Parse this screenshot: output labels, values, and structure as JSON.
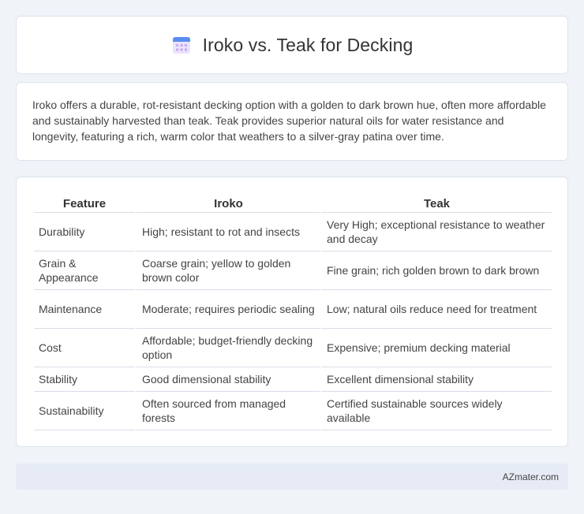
{
  "header": {
    "title": "Iroko vs. Teak for Decking",
    "icon": "calendar-icon",
    "icon_colors": {
      "top": "#5b8def",
      "grid": "#c9a6f5",
      "body": "#e9e3fb"
    }
  },
  "intro": {
    "text": "Iroko offers a durable, rot-resistant decking option with a golden to dark brown hue, often more affordable and sustainably harvested than teak. Teak provides superior natural oils for water resistance and longevity, featuring a rich, warm color that weathers to a silver-gray patina over time."
  },
  "table": {
    "headers": [
      "Feature",
      "Iroko",
      "Teak"
    ],
    "rows": [
      {
        "feature": "Durability",
        "iroko": "High; resistant to rot and insects",
        "teak": "Very High; exceptional resistance to weather and decay"
      },
      {
        "feature": "Grain & Appearance",
        "iroko": "Coarse grain; yellow to golden brown color",
        "teak": "Fine grain; rich golden brown to dark brown"
      },
      {
        "feature": "Maintenance",
        "iroko": "Moderate; requires periodic sealing",
        "teak": "Low; natural oils reduce need for treatment"
      },
      {
        "feature": "Cost",
        "iroko": "Affordable; budget-friendly decking option",
        "teak": "Expensive; premium decking material"
      },
      {
        "feature": "Stability",
        "iroko": "Good dimensional stability",
        "teak": "Excellent dimensional stability"
      },
      {
        "feature": "Sustainability",
        "iroko": "Often sourced from managed forests",
        "teak": "Certified sustainable sources widely available"
      }
    ]
  },
  "footer": {
    "text": "AZmater.com"
  }
}
